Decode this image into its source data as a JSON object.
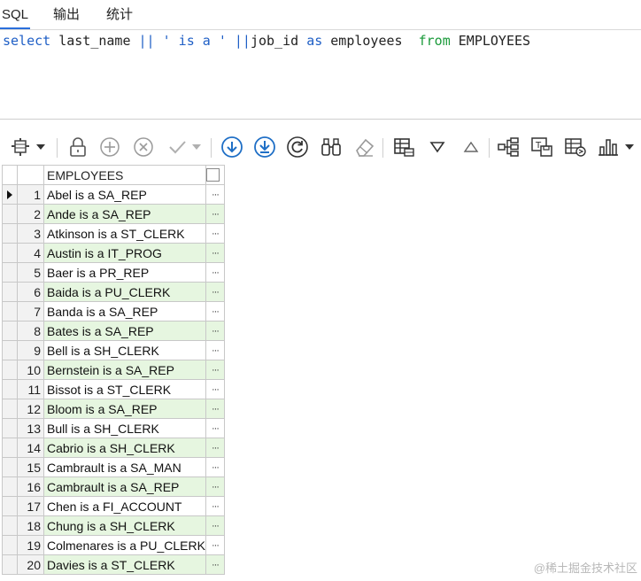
{
  "tabs": [
    "SQL",
    "输出",
    "统计"
  ],
  "editor": {
    "kw_select": "select",
    "t1": " last_name ",
    "op1": "||",
    "str1": " ' is a ' ",
    "op2": "||",
    "t2": "job_id ",
    "kw_as": "as",
    "t3": " employees  ",
    "kw_from": "from",
    "t4": " EMPLOYEES"
  },
  "grid": {
    "column": "EMPLOYEES",
    "ellipsis": "···",
    "rows": [
      {
        "n": "1",
        "v": "Abel is a SA_REP"
      },
      {
        "n": "2",
        "v": "Ande is a SA_REP"
      },
      {
        "n": "3",
        "v": "Atkinson is a ST_CLERK"
      },
      {
        "n": "4",
        "v": "Austin is a IT_PROG"
      },
      {
        "n": "5",
        "v": "Baer is a PR_REP"
      },
      {
        "n": "6",
        "v": "Baida is a PU_CLERK"
      },
      {
        "n": "7",
        "v": "Banda is a SA_REP"
      },
      {
        "n": "8",
        "v": "Bates is a SA_REP"
      },
      {
        "n": "9",
        "v": "Bell is a SH_CLERK"
      },
      {
        "n": "10",
        "v": "Bernstein is a SA_REP"
      },
      {
        "n": "11",
        "v": "Bissot is a ST_CLERK"
      },
      {
        "n": "12",
        "v": "Bloom is a SA_REP"
      },
      {
        "n": "13",
        "v": "Bull is a SH_CLERK"
      },
      {
        "n": "14",
        "v": "Cabrio is a SH_CLERK"
      },
      {
        "n": "15",
        "v": "Cambrault is a SA_MAN"
      },
      {
        "n": "16",
        "v": "Cambrault is a SA_REP"
      },
      {
        "n": "17",
        "v": "Chen is a FI_ACCOUNT"
      },
      {
        "n": "18",
        "v": "Chung is a SH_CLERK"
      },
      {
        "n": "19",
        "v": "Colmenares is a PU_CLERK"
      },
      {
        "n": "20",
        "v": "Davies is a ST_CLERK"
      }
    ]
  },
  "watermark": "@稀土掘金技术社区",
  "icons": [
    "grid-layout-icon",
    "lock-icon",
    "add-icon",
    "remove-icon",
    "check-icon",
    "fetch-next-icon",
    "fetch-all-icon",
    "refresh-icon",
    "binoculars-icon",
    "eraser-icon",
    "table-view-icon",
    "filter-down-icon",
    "filter-up-icon",
    "tree-icon",
    "export-icon",
    "table-export-icon",
    "chart-icon"
  ]
}
